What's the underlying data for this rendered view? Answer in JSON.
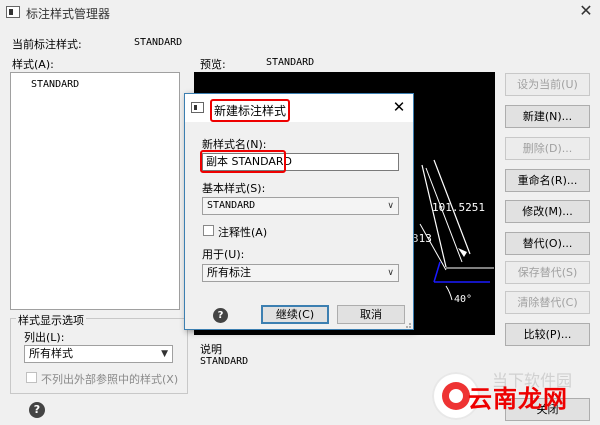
{
  "window": {
    "title": "标注样式管理器",
    "close_glyph": "✕"
  },
  "current_style": {
    "label": "当前标注样式:",
    "value": "STANDARD"
  },
  "styles": {
    "label": "样式(A):",
    "items": [
      "STANDARD"
    ]
  },
  "preview": {
    "label": "预览:",
    "name": "STANDARD",
    "dimension_value": "101.5251",
    "partial_value": "313",
    "angle_value": "40°"
  },
  "buttons": {
    "set_current": "设为当前(U)",
    "new": "新建(N)...",
    "delete": "删除(D)...",
    "rename": "重命名(R)...",
    "modify": "修改(M)...",
    "override": "替代(O)...",
    "save_override": "保存替代(S)",
    "clear_override": "清除替代(C)",
    "compare": "比较(P)...",
    "close": "关闭"
  },
  "display_options": {
    "group_label": "样式显示选项",
    "list_label": "列出(L):",
    "list_value": "所有样式",
    "exclude_xref_label": "不列出外部参照中的样式(X)"
  },
  "description": {
    "label": "说明",
    "value": "STANDARD"
  },
  "dialog": {
    "title": "新建标注样式",
    "close_glyph": "✕",
    "name_label": "新样式名(N):",
    "name_value": "副本 STANDARD",
    "base_label": "基本样式(S):",
    "base_value": "STANDARD",
    "annotative_label": "注释性(A)",
    "use_for_label": "用于(U):",
    "use_for_value": "所有标注",
    "continue": "继续(C)",
    "cancel": "取消"
  },
  "watermark": {
    "text": "云南龙网",
    "faint_text": "当下软件园"
  },
  "colors": {
    "highlight": "#e00000",
    "preview_bg": "#000000",
    "preview_line": "#ffffff",
    "preview_accent": "#1a1aff"
  },
  "icons": [
    "window-app-icon",
    "close-icon",
    "help-icon",
    "chevron-down-icon"
  ]
}
